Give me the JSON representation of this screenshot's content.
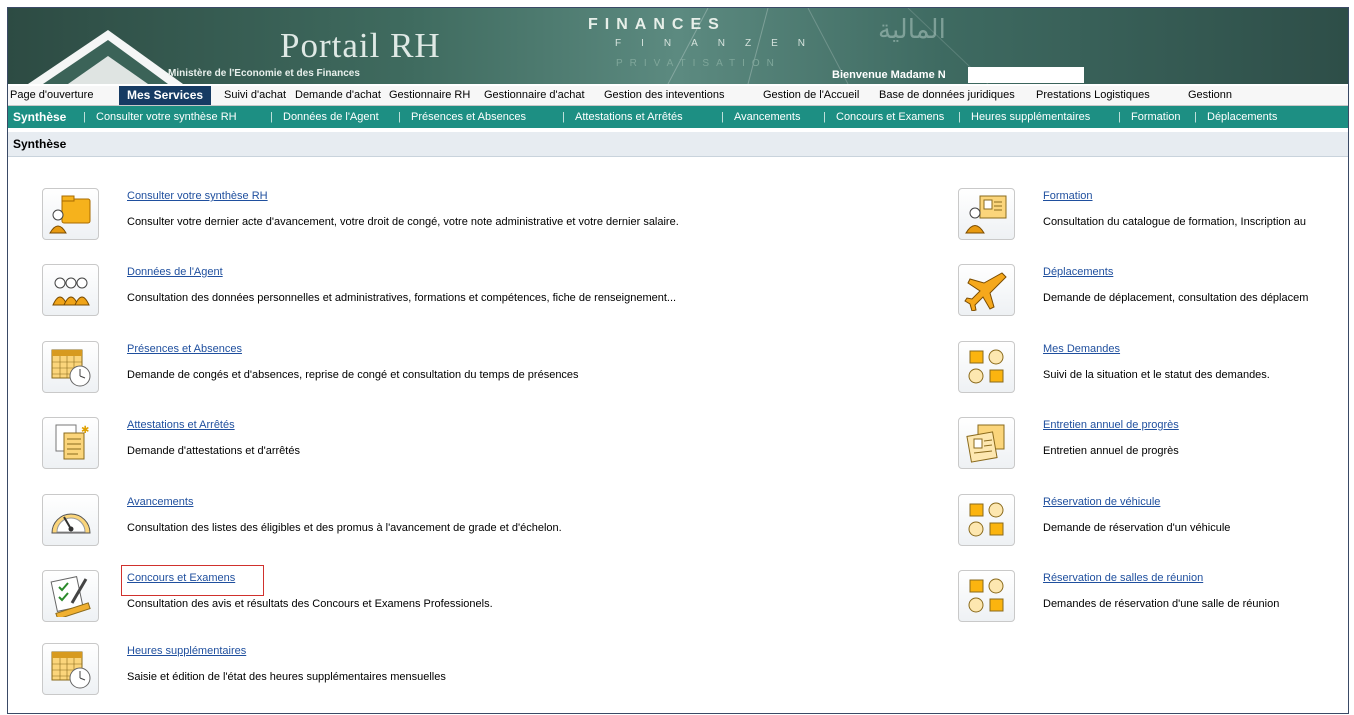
{
  "banner": {
    "portal_title": "Portail RH",
    "ministry": "Ministère de l'Economie et des Finances",
    "finances_line1": "FINANCES",
    "finances_line2": "FINANZEN",
    "finances_line3": "PRIVATISATION",
    "welcome": "Bienvenue Madame N"
  },
  "topnav": [
    "Page d'ouverture",
    "Mes Services",
    "Suivi d'achat",
    "Demande d'achat",
    "Gestionnaire RH",
    "Gestionnaire d'achat",
    "Gestion des inteventions",
    "Gestion de l'Accueil",
    "Base de données juridiques",
    "Prestations Logistiques",
    "Gestionn"
  ],
  "subnav": [
    "Synthèse",
    "Consulter votre synthèse RH",
    "Données de l'Agent",
    "Présences et Absences",
    "Attestations et Arrêtés",
    "Avancements",
    "Concours et Examens",
    "Heures supplémentaires",
    "Formation",
    "Déplacements"
  ],
  "page_title": "Synthèse",
  "left_items": [
    {
      "icon": "folder-person-icon",
      "title": "Consulter votre synthèse RH",
      "desc": "Consulter votre dernier acte d'avancement, votre droit de congé, votre note administrative et votre dernier salaire."
    },
    {
      "icon": "group-people-icon",
      "title": "Données de l'Agent",
      "desc": "Consultation des données personnelles et administratives, formations et compétences, fiche de renseignement..."
    },
    {
      "icon": "calendar-clock-icon",
      "title": "Présences et Absences",
      "desc": "Demande de congés et d'absences, reprise de congé et consultation du temps de présences"
    },
    {
      "icon": "documents-icon",
      "title": "Attestations et Arrêtés",
      "desc": "Demande d'attestations et d'arrêtés"
    },
    {
      "icon": "gauge-icon",
      "title": "Avancements",
      "desc": "Consultation des listes des éligibles et des promus à l'avancement de grade et d'échelon."
    },
    {
      "icon": "exam-paper-icon",
      "title": "Concours et Examens",
      "desc": "Consultation des avis et résultats des Concours et Examens Professionels."
    },
    {
      "icon": "calendar-clock-icon",
      "title": "Heures supplémentaires",
      "desc": "Saisie et édition de l'état des heures supplémentaires mensuelles"
    }
  ],
  "right_items": [
    {
      "icon": "id-card-person-icon",
      "title": "Formation",
      "desc": "Consultation du catalogue de formation, Inscription au"
    },
    {
      "icon": "airplane-icon",
      "title": "Déplacements",
      "desc": "Demande de déplacement, consultation des déplacem"
    },
    {
      "icon": "shapes-grid-icon",
      "title": "Mes Demandes",
      "desc": "Suivi de la situation et le statut des demandes."
    },
    {
      "icon": "appraisal-folder-icon",
      "title": "Entretien annuel de progrès",
      "desc": "Entretien annuel de progrès"
    },
    {
      "icon": "shapes-grid-icon",
      "title": "Réservation de véhicule",
      "desc": "Demande de réservation d'un véhicule"
    },
    {
      "icon": "shapes-grid-icon",
      "title": "Réservation de salles de réunion",
      "desc": "Demandes de réservation d'une salle de réunion"
    }
  ]
}
